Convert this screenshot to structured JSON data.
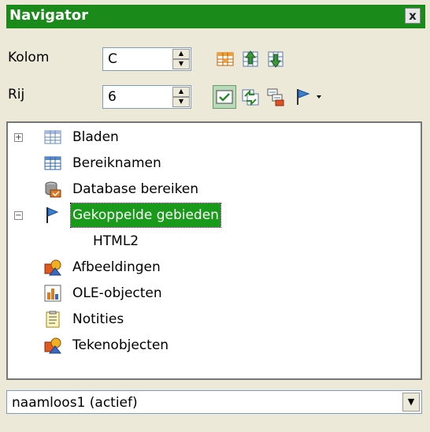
{
  "window": {
    "title": "Navigator",
    "close_glyph": "x"
  },
  "controls": {
    "column_label": "Kolom",
    "column_value": "C",
    "row_label": "Rij",
    "row_value": "6"
  },
  "toolbar": {
    "icons": [
      "data-area-icon",
      "start-icon",
      "end-icon",
      "contents-icon",
      "toggle-icon",
      "scenarios-icon",
      "drag-mode-icon"
    ]
  },
  "tree": {
    "items": [
      {
        "label": "Bladen",
        "icon": "sheets-icon",
        "expander": "+"
      },
      {
        "label": "Bereiknamen",
        "icon": "range-names-icon"
      },
      {
        "label": "Database bereiken",
        "icon": "database-ranges-icon"
      },
      {
        "label": "Gekoppelde gebieden",
        "icon": "linked-areas-icon",
        "expander": "−",
        "selected": true
      },
      {
        "label": "HTML2",
        "icon": ""
      },
      {
        "label": "Afbeeldingen",
        "icon": "images-icon"
      },
      {
        "label": "OLE-objecten",
        "icon": "ole-objects-icon"
      },
      {
        "label": "Notities",
        "icon": "notes-icon"
      },
      {
        "label": "Tekenobjecten",
        "icon": "drawing-objects-icon"
      }
    ]
  },
  "document_select": {
    "value": "naamloos1 (actief)"
  },
  "colors": {
    "title_bar": "#1a8a1a",
    "selection": "#1a9a1a"
  }
}
